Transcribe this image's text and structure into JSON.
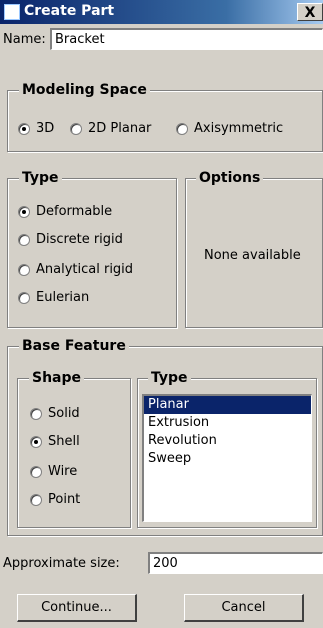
{
  "window": {
    "title": "Create Part",
    "close_glyph": "X"
  },
  "name": {
    "label": "Name:",
    "value": "Bracket"
  },
  "modeling_space": {
    "title": "Modeling Space",
    "options": [
      {
        "label": "3D",
        "selected": true
      },
      {
        "label": "2D Planar",
        "selected": false
      },
      {
        "label": "Axisymmetric",
        "selected": false
      }
    ]
  },
  "type": {
    "title": "Type",
    "options": [
      {
        "label": "Deformable",
        "selected": true
      },
      {
        "label": "Discrete rigid",
        "selected": false
      },
      {
        "label": "Analytical rigid",
        "selected": false
      },
      {
        "label": "Eulerian",
        "selected": false
      }
    ]
  },
  "options": {
    "title": "Options",
    "text": "None available"
  },
  "base_feature": {
    "title": "Base Feature",
    "shape": {
      "title": "Shape",
      "options": [
        {
          "label": "Solid",
          "selected": false
        },
        {
          "label": "Shell",
          "selected": true
        },
        {
          "label": "Wire",
          "selected": false
        },
        {
          "label": "Point",
          "selected": false
        }
      ]
    },
    "type": {
      "title": "Type",
      "items": [
        "Planar",
        "Extrusion",
        "Revolution",
        "Sweep"
      ],
      "selected": "Planar"
    }
  },
  "approx_size": {
    "label": "Approximate size:",
    "value": "200"
  },
  "buttons": {
    "continue": "Continue...",
    "cancel": "Cancel"
  }
}
